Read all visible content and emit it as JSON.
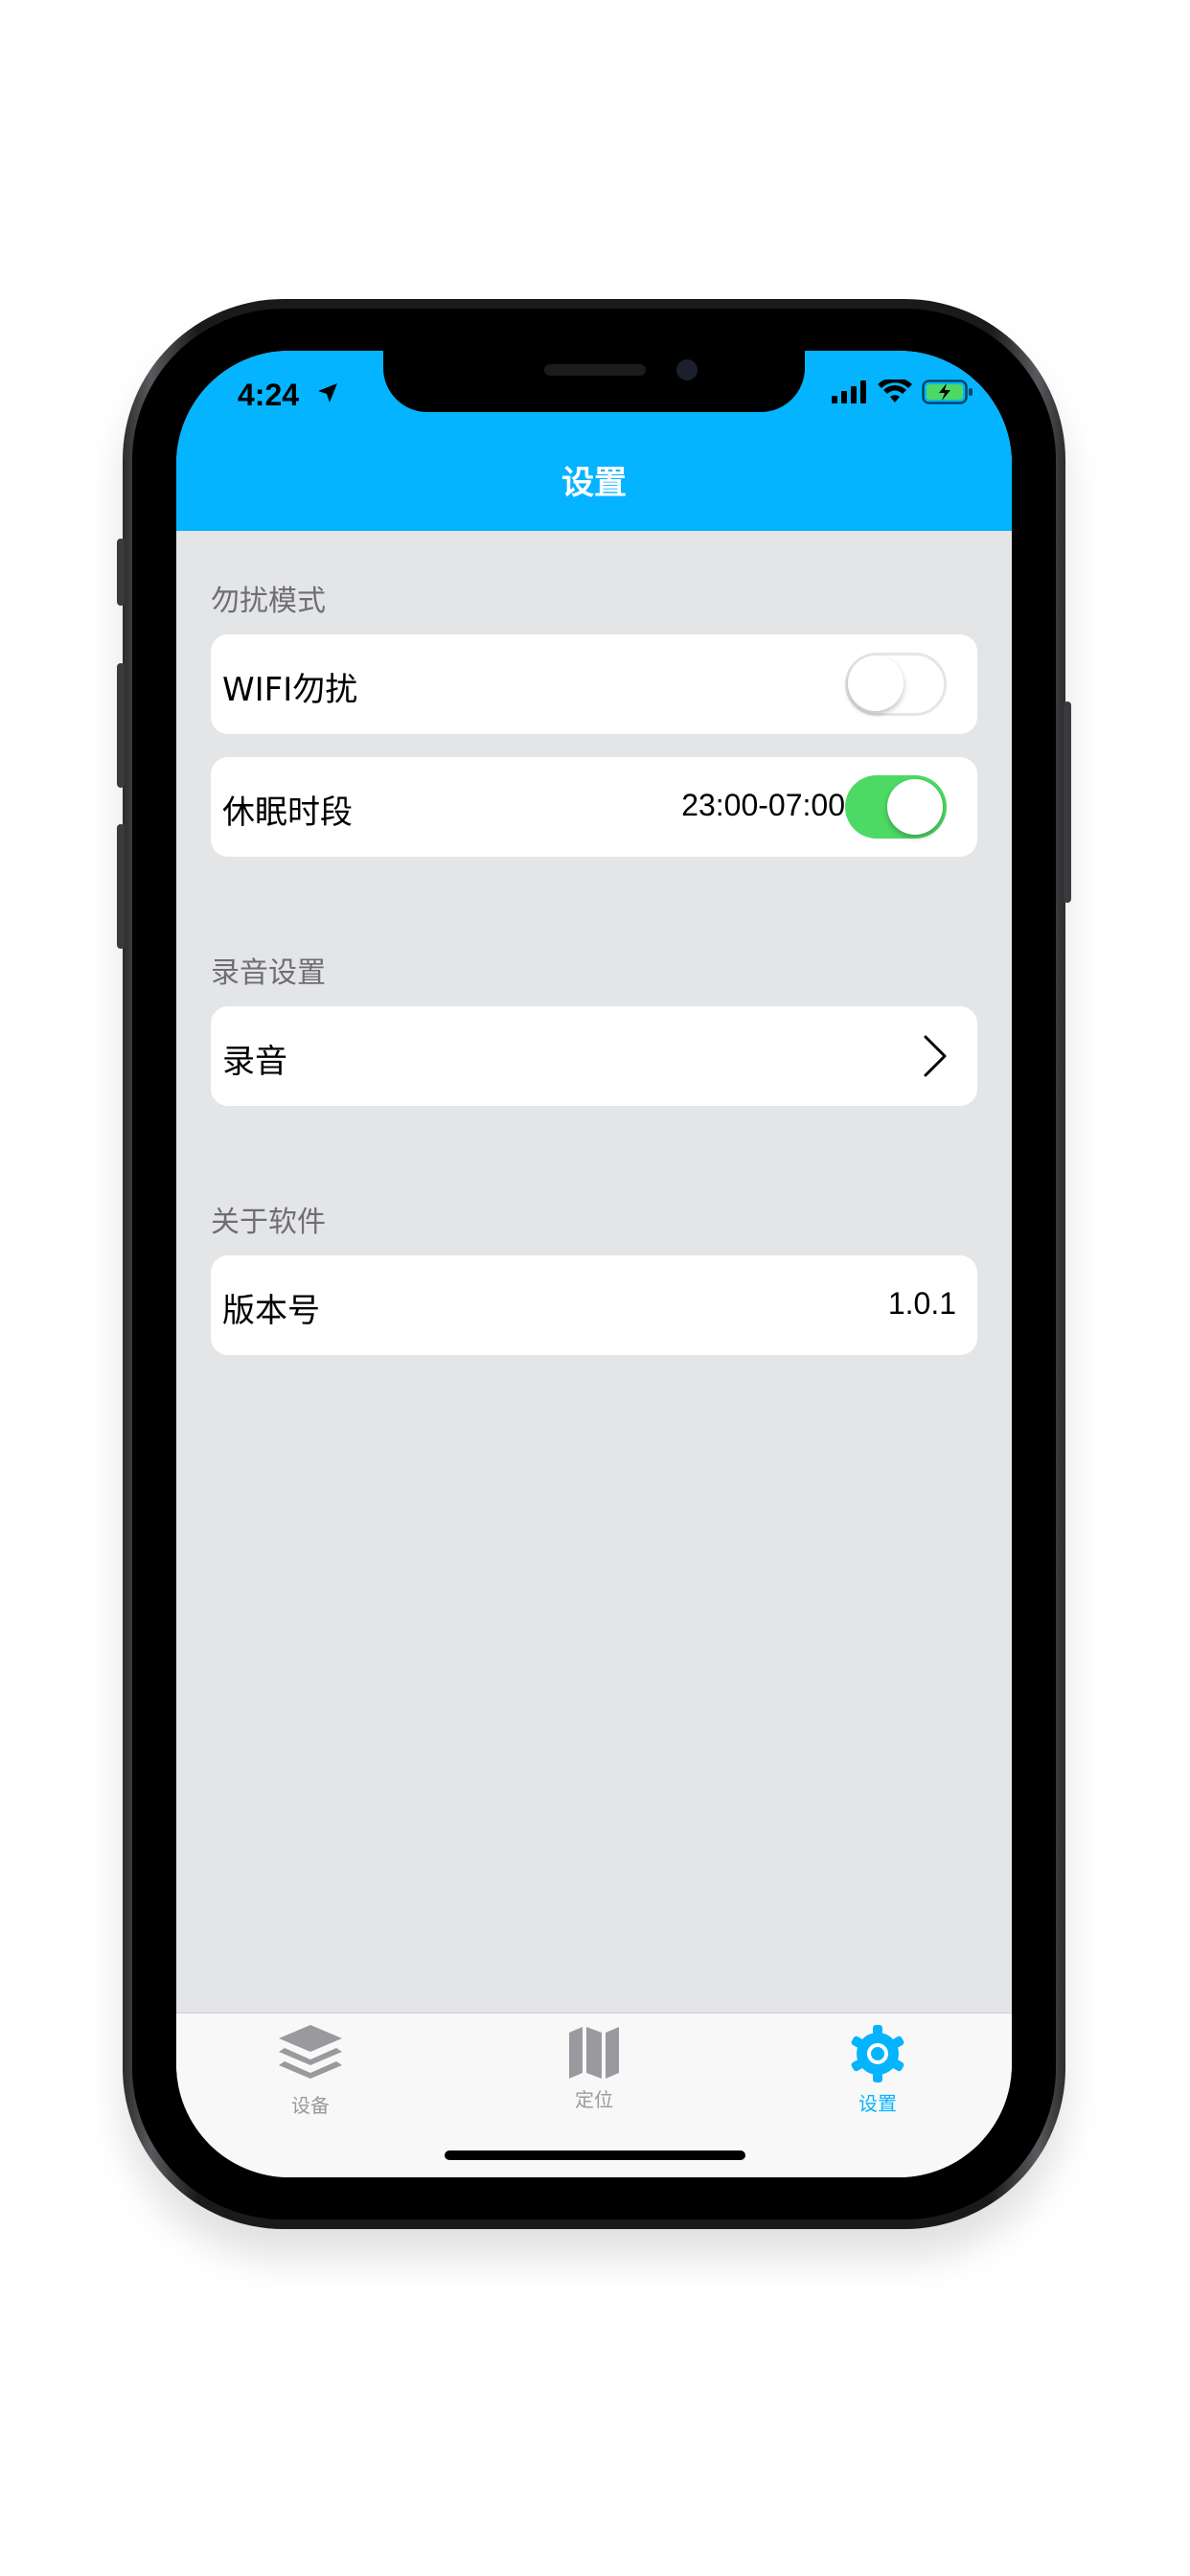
{
  "status_bar": {
    "time": "4:24"
  },
  "header": {
    "title": "设置"
  },
  "sections": [
    {
      "title": "勿扰模式"
    },
    {
      "title": "录音设置"
    },
    {
      "title": "关于软件"
    }
  ],
  "rows": {
    "wifi": {
      "label": "WIFI勿扰",
      "toggle_on": false
    },
    "sleep": {
      "label": "休眠时段",
      "value": "23:00-07:00",
      "toggle_on": true
    },
    "record": {
      "label": "录音"
    },
    "version": {
      "label": "版本号",
      "value": "1.0.1"
    }
  },
  "tabs": [
    {
      "label": "设备",
      "icon": "layers-icon",
      "active": false
    },
    {
      "label": "定位",
      "icon": "map-icon",
      "active": false
    },
    {
      "label": "设置",
      "icon": "gear-icon",
      "active": true
    }
  ],
  "colors": {
    "accent": "#05b4ff",
    "toggle_on": "#4cd964",
    "background": "#e4e5e7",
    "tab_inactive": "#9a9a9e"
  }
}
